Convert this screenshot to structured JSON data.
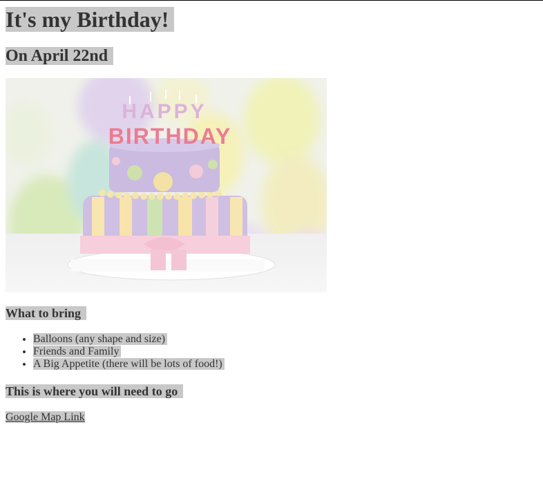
{
  "heading": "It's my Birthday!",
  "date": "On April 22nd",
  "image": {
    "description_icon": "birthday-cake-image",
    "cake_lettering_top": "HAPPY",
    "cake_lettering_bottom": "BIRTHDAY"
  },
  "bring": {
    "title": "What to bring",
    "items": [
      "Balloons (any shape and size)",
      "Friends and Family",
      "A Big Appetite (there will be lots of food!)"
    ]
  },
  "location": {
    "title": "This is where you will need to go",
    "link_label": "Google Map Link"
  },
  "colors": {
    "highlight": "#c8c8c8",
    "text": "#333333"
  }
}
